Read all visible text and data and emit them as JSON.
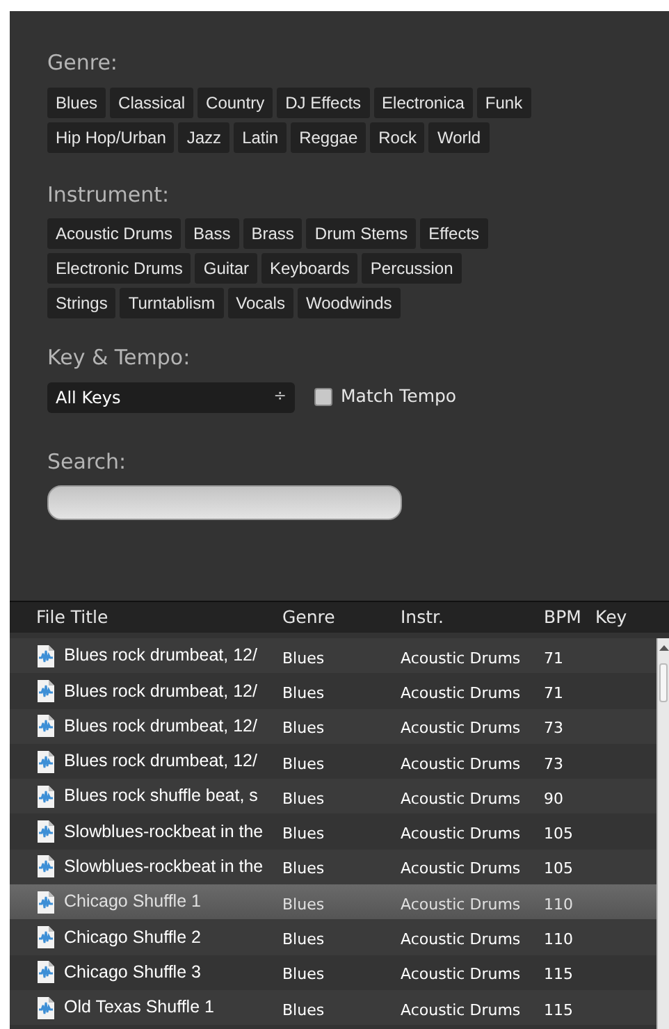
{
  "genre": {
    "label": "Genre:",
    "tags": [
      "Blues",
      "Classical",
      "Country",
      "DJ Effects",
      "Electronica",
      "Funk",
      "Hip Hop/Urban",
      "Jazz",
      "Latin",
      "Reggae",
      "Rock",
      "World"
    ]
  },
  "instrument": {
    "label": "Instrument:",
    "tags": [
      "Acoustic Drums",
      "Bass",
      "Brass",
      "Drum Stems",
      "Effects",
      "Electronic Drums",
      "Guitar",
      "Keyboards",
      "Percussion",
      "Strings",
      "Turntablism",
      "Vocals",
      "Woodwinds"
    ]
  },
  "key_tempo": {
    "label": "Key & Tempo:",
    "key_select": "All Keys",
    "select_arrows": "÷",
    "match_tempo": {
      "label": "Match Tempo",
      "checked": false
    }
  },
  "search": {
    "label": "Search:"
  },
  "table": {
    "columns": [
      "File Title",
      "Genre",
      "Instr.",
      "BPM",
      "Key"
    ],
    "rows": [
      {
        "title": "Blues rock drumbeat, 12/",
        "genre": "Blues",
        "instr": "Acoustic Drums",
        "bpm": "71",
        "selected": false
      },
      {
        "title": "Blues rock drumbeat, 12/",
        "genre": "Blues",
        "instr": "Acoustic Drums",
        "bpm": "71",
        "selected": false
      },
      {
        "title": "Blues rock drumbeat, 12/",
        "genre": "Blues",
        "instr": "Acoustic Drums",
        "bpm": "73",
        "selected": false
      },
      {
        "title": "Blues rock drumbeat, 12/",
        "genre": "Blues",
        "instr": "Acoustic Drums",
        "bpm": "73",
        "selected": false
      },
      {
        "title": "Blues rock shuffle beat, s",
        "genre": "Blues",
        "instr": "Acoustic Drums",
        "bpm": "90",
        "selected": false
      },
      {
        "title": "Slowblues-rockbeat in the",
        "genre": "Blues",
        "instr": "Acoustic Drums",
        "bpm": "105",
        "selected": false
      },
      {
        "title": "Slowblues-rockbeat in the",
        "genre": "Blues",
        "instr": "Acoustic Drums",
        "bpm": "105",
        "selected": false
      },
      {
        "title": "Chicago Shuffle 1",
        "genre": "Blues",
        "instr": "Acoustic Drums",
        "bpm": "110",
        "selected": true
      },
      {
        "title": "Chicago Shuffle 2",
        "genre": "Blues",
        "instr": "Acoustic Drums",
        "bpm": "110",
        "selected": false
      },
      {
        "title": "Chicago Shuffle 3",
        "genre": "Blues",
        "instr": "Acoustic Drums",
        "bpm": "115",
        "selected": false
      },
      {
        "title": "Old Texas Shuffle 1",
        "genre": "Blues",
        "instr": "Acoustic Drums",
        "bpm": "115",
        "selected": false
      }
    ]
  }
}
